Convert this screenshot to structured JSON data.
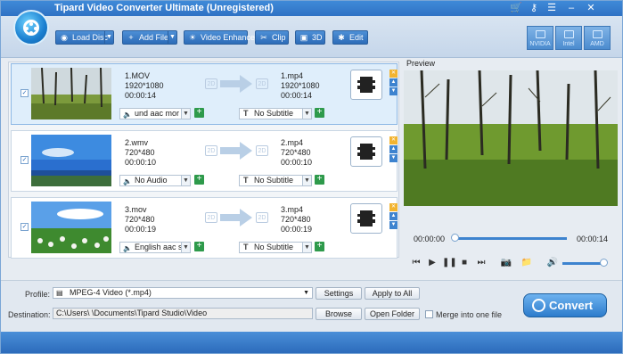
{
  "window": {
    "title": "Tipard Video Converter Ultimate (Unregistered)",
    "controls": [
      "cart-icon",
      "key-icon",
      "list-icon",
      "minimize",
      "close"
    ]
  },
  "toolbar": {
    "load_disc": "Load Disc",
    "add_file": "Add File",
    "video_enhance": "Video Enhance",
    "clip": "Clip",
    "three_d": "3D",
    "edit": "Edit",
    "accel": [
      "NVIDIA",
      "Intel",
      "AMD"
    ]
  },
  "files": [
    {
      "name": "1.MOV",
      "resolution": "1920*1080",
      "duration": "00:00:14",
      "out_name": "1.mp4",
      "out_resolution": "1920*1080",
      "out_duration": "00:00:14",
      "audio": "und aac mor",
      "subtitle": "No Subtitle",
      "thumb": "forest"
    },
    {
      "name": "2.wmv",
      "resolution": "720*480",
      "duration": "00:00:10",
      "out_name": "2.mp4",
      "out_resolution": "720*480",
      "out_duration": "00:00:10",
      "audio": "No Audio",
      "subtitle": "No Subtitle",
      "thumb": "beach"
    },
    {
      "name": "3.mov",
      "resolution": "720*480",
      "duration": "00:00:19",
      "out_name": "3.mp4",
      "out_resolution": "720*480",
      "out_duration": "00:00:19",
      "audio": "English aac s",
      "subtitle": "No Subtitle",
      "thumb": "flowers"
    }
  ],
  "preview": {
    "label": "Preview",
    "time_current": "00:00:00",
    "time_total": "00:00:14",
    "progress": 0,
    "volume": 0.95
  },
  "profile": {
    "label": "Profile:",
    "value": "MPEG-4 Video (*.mp4)",
    "settings": "Settings",
    "apply_all": "Apply to All"
  },
  "destination": {
    "label": "Destination:",
    "value": "C:\\Users\\          \\Documents\\Tipard Studio\\Video",
    "browse": "Browse",
    "open_folder": "Open Folder",
    "merge": "Merge into one file"
  },
  "convert_label": "Convert",
  "colors": {
    "accent": "#2d7ccc",
    "selected_row": "#dfeefb",
    "add_green": "#2e9a4b"
  }
}
